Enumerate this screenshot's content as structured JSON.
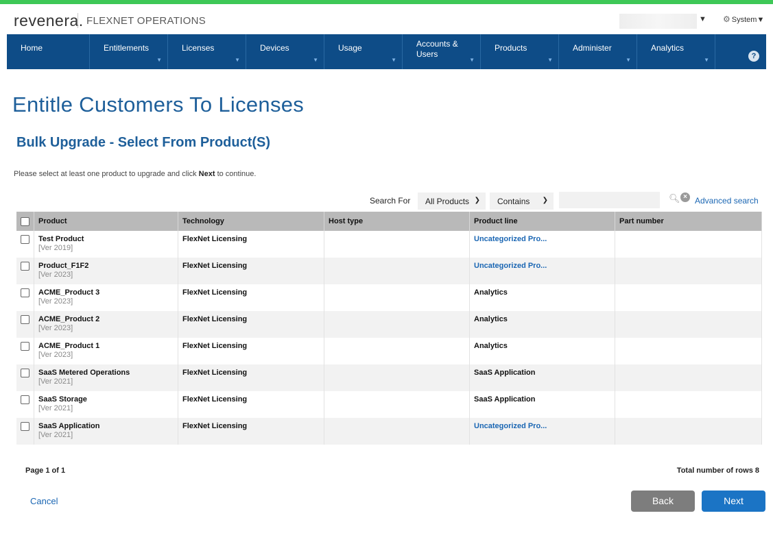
{
  "header": {
    "logo_text": "revenera.",
    "product_name": "FLEXNET OPERATIONS",
    "user_caret": "▼",
    "system_menu": "System▼"
  },
  "nav": {
    "items": [
      {
        "label": "Home"
      },
      {
        "label": "Entitlements"
      },
      {
        "label": "Licenses"
      },
      {
        "label": "Devices"
      },
      {
        "label": "Usage"
      },
      {
        "label": "Accounts &\nUsers"
      },
      {
        "label": "Products"
      },
      {
        "label": "Administer"
      },
      {
        "label": "Analytics"
      }
    ],
    "help": "?"
  },
  "page": {
    "title": "Entitle Customers To Licenses",
    "subtitle": "Bulk Upgrade - Select From Product(S)",
    "instructions_pre": "Please select at least one product to upgrade and click ",
    "instructions_bold": "Next",
    "instructions_post": " to continue."
  },
  "search": {
    "label": "Search For",
    "scope_value": "All Products",
    "operator_value": "Contains",
    "input_value": "",
    "advanced_link": "Advanced search"
  },
  "table": {
    "columns": [
      "Product",
      "Technology",
      "Host type",
      "Product line",
      "Part number"
    ],
    "rows": [
      {
        "name": "Test Product",
        "version": "[Ver 2019]",
        "technology": "FlexNet Licensing",
        "host_type": "",
        "product_line": "Uncategorized Pro...",
        "part_number": ""
      },
      {
        "name": "Product_F1F2",
        "version": "[Ver 2023]",
        "technology": "FlexNet Licensing",
        "host_type": "",
        "product_line": "Uncategorized Pro...",
        "part_number": ""
      },
      {
        "name": "ACME_Product 3",
        "version": "[Ver 2023]",
        "technology": "FlexNet Licensing",
        "host_type": "",
        "product_line": "Analytics",
        "part_number": ""
      },
      {
        "name": "ACME_Product 2",
        "version": "[Ver 2023]",
        "technology": "FlexNet Licensing",
        "host_type": "",
        "product_line": "Analytics",
        "part_number": ""
      },
      {
        "name": "ACME_Product 1",
        "version": "[Ver 2023]",
        "technology": "FlexNet Licensing",
        "host_type": "",
        "product_line": "Analytics",
        "part_number": ""
      },
      {
        "name": "SaaS Metered Operations",
        "version": "[Ver 2021]",
        "technology": "FlexNet Licensing",
        "host_type": "",
        "product_line": "SaaS Application",
        "part_number": ""
      },
      {
        "name": "SaaS Storage",
        "version": "[Ver 2021]",
        "technology": "FlexNet Licensing",
        "host_type": "",
        "product_line": "SaaS Application",
        "part_number": ""
      },
      {
        "name": "SaaS Application",
        "version": "[Ver 2021]",
        "technology": "FlexNet Licensing",
        "host_type": "",
        "product_line": "Uncategorized Pro...",
        "part_number": ""
      }
    ]
  },
  "footer": {
    "page_info": "Page 1 of 1",
    "total_rows": "Total number of rows 8",
    "cancel": "Cancel",
    "back": "Back",
    "next": "Next"
  },
  "colors": {
    "accent_bar": "#3ec857",
    "nav_background": "#0e4c87",
    "title_blue": "#1e5f9a",
    "link_blue": "#1a66b3",
    "next_button": "#1b74c5",
    "back_button": "#7d7d7d"
  }
}
